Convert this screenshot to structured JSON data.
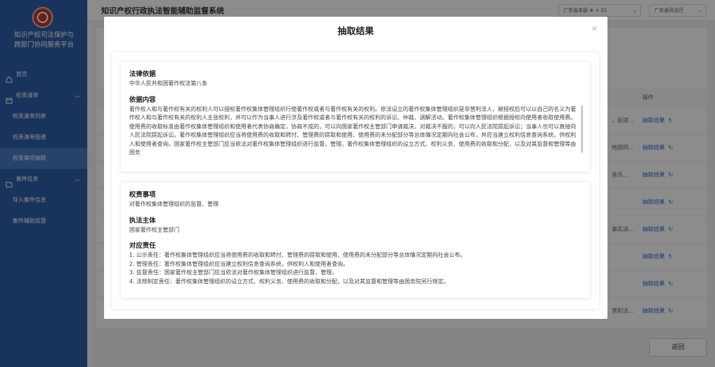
{
  "sidebar": {
    "org_name_line1": "知识产权司法保护与",
    "org_name_line2": "跨部门协同服务平台",
    "items": [
      {
        "label": "首页"
      },
      {
        "label": "权责清单"
      },
      {
        "label": "权责清单列表"
      },
      {
        "label": "权责清单图谱"
      },
      {
        "label": "权责事项抽取"
      },
      {
        "label": "案件信息"
      },
      {
        "label": "导入案件信息"
      },
      {
        "label": "案件辅助监督"
      }
    ]
  },
  "topbar": {
    "title": "知识产权行政执法智能辅助监督系统",
    "select1": "广东省本级 ⊗ + 21",
    "select2": "广东省司法厅"
  },
  "table": {
    "op_header": "操作",
    "rows": [
      {
        "desc": "，促进...",
        "action": "抽取结果"
      },
      {
        "desc": "地国同...",
        "action": "抽取结果"
      },
      {
        "desc": "音乐...",
        "action": "抽取结果"
      },
      {
        "desc": "",
        "action": "抽取结果"
      },
      {
        "desc": "事实消...",
        "action": "抽取结果"
      },
      {
        "desc": "",
        "action": "抽取结果"
      },
      {
        "desc": "",
        "action": "抽取结果"
      },
      {
        "desc": "营利法...",
        "action": "抽取结果"
      }
    ],
    "back_label": "返回"
  },
  "modal": {
    "title": "抽取结果",
    "close": "×",
    "legal_basis_title": "法律依据",
    "legal_basis_text": "中华人民共和国著作权法第八条",
    "basis_content_title": "依据内容",
    "basis_content_text": "著作权人和与著作权有关的权利人可以授权著作权集体管理组织行使著作权或者与著作权有关的权利。依法设立的著作权集体管理组织是非营利法人，被授权后可以以自己的名义为著作权人和与著作权有关的权利人主张权利，并可以作为当事人进行涉及著作权或者与著作权有关的权利的诉讼、仲裁、调解活动。著作权集体管理组织根据授权向使用者收取使用费。使用费的收取标准由著作权集体管理组织和使用者代表协商确定，协商不成的，可以向国家著作权主管部门申请裁决，对裁决不服的，可以向人民法院提起诉讼；当事人也可以直接向人民法院提起诉讼。著作权集体管理组织应当将使用费的收取和转付、管理费的提取和使用、使用费的未分配部分等总体情况定期向社会公布，并应当建立权利信息查询系统，供权利人和使用者查询。国家著作权主管部门应当依法对著作权集体管理组织进行监督、管理。著作权集体管理组织的设立方式、权利义务、使用费的收取和分配，以及对其监督和管理等由国务",
    "matter_title": "权责事项",
    "matter_text": "对著作权集体管理组织的监督、管理",
    "subject_title": "执法主体",
    "subject_text": "国家著作权主管部门",
    "duty_title": "对应责任",
    "duties": [
      "1. 公示责任：著作权集体管理组织应当将使用费的收取和转付、管理费的提取和使用、使用费的未分配部分等总体情况定期向社会公布。",
      "2. 管理责任：著作权集体管理组织应当建立权利信息查询系统，供权利人和使用者查询。",
      "3. 监督责任：国家著作权主管部门应当依法对著作权集体管理组织进行监督、管理。",
      "4. 法规制定责任：著作权集体管理组织的设立方式、权利义务、使用费的收取和分配，以及对其监督和管理等由国务院另行规定。"
    ]
  }
}
